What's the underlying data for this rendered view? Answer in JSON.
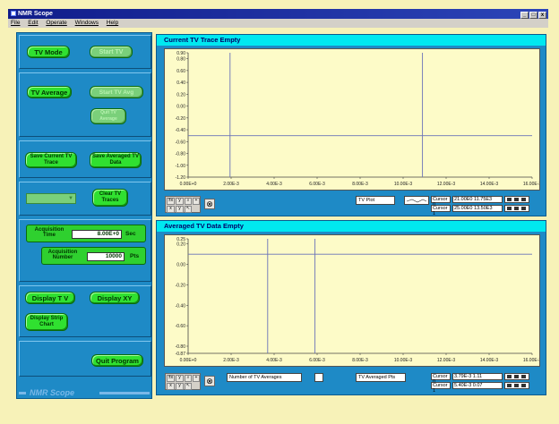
{
  "window": {
    "title": "NMR Scope",
    "menu": [
      "File",
      "Edit",
      "Operate",
      "Windows",
      "Help"
    ],
    "buttons": [
      "_",
      "□",
      "x"
    ]
  },
  "controls": {
    "tv_mode": "TV Mode",
    "start_tv": "Start TV",
    "tv_average": "TV Average",
    "start_tv_avg": "Start TV Avg",
    "quit_tv_average": "Quit TV Average",
    "save_current_tv_trace": "Save Current TV Trace",
    "save_averaged_tv_data": "Save Averaged TV Data",
    "dropdown_value": "",
    "clear_tv_traces": "Clear TV Traces",
    "acquisition_time_label": "Acquisition Time",
    "acquisition_time_value": "8.00E+0",
    "acquisition_time_unit": "Sec",
    "acquisition_number_label": "Acquisition Number",
    "acquisition_number_value": "10000",
    "acquisition_number_unit": "Pts",
    "display_tv": "Display T V",
    "display_xy": "Display XY",
    "display_strip_chart": "Display Strip Chart",
    "quit_program": "Quit Program",
    "brand": "NMR Scope"
  },
  "graph1": {
    "title": "Current TV Trace Empty",
    "plot_label": "TV Plot",
    "cursors": [
      {
        "name": "Cursor 0",
        "value": "21.00E0 11.75E3"
      },
      {
        "name": "Cursor 1",
        "value": "25.00E0 13.50E3"
      }
    ]
  },
  "graph2": {
    "title": "Averaged TV Data Empty",
    "navg_label": "Number of TV Averages",
    "plot_label": "TV Averaged Pts",
    "cursors": [
      {
        "name": "Cursor 0",
        "value": "3.79E-3 1.11"
      },
      {
        "name": "Cursor 1",
        "value": "5.40E-3 0.07"
      }
    ]
  },
  "chart_data": [
    {
      "type": "line",
      "title": "Current TV Trace Empty",
      "x_ticks": [
        "0.00E+0",
        "2.00E-3",
        "4.00E-3",
        "6.00E-3",
        "8.00E-3",
        "10.00E-3",
        "12.00E-3",
        "14.00E-3",
        "16.00E-3"
      ],
      "y_ticks": [
        "0.90",
        "0.80",
        "0.60",
        "0.40",
        "0.20",
        "0.00",
        "-0.20",
        "-0.40",
        "-0.60",
        "-0.80",
        "-1.00",
        "-1.20"
      ],
      "xlim": [
        0,
        0.016
      ],
      "ylim": [
        -1.2,
        0.9
      ],
      "cursors_x": [
        0.00195,
        0.0109
      ],
      "cursor_y": -0.5,
      "series": []
    },
    {
      "type": "line",
      "title": "Averaged TV Data Empty",
      "x_ticks": [
        "0.00E+0",
        "2.00E-3",
        "4.00E-3",
        "6.00E-3",
        "8.00E-3",
        "10.00E-3",
        "12.00E-3",
        "14.00E-3",
        "16.00E-3"
      ],
      "y_ticks": [
        "0.25",
        "0.20",
        "0.00",
        "-0.20",
        "-0.40",
        "-0.60",
        "-0.80",
        "-0.87"
      ],
      "xlim": [
        0,
        0.016
      ],
      "ylim": [
        -0.87,
        0.25
      ],
      "cursors_x": [
        0.0037,
        0.0059
      ],
      "cursor_y": 0.1,
      "series": []
    }
  ]
}
